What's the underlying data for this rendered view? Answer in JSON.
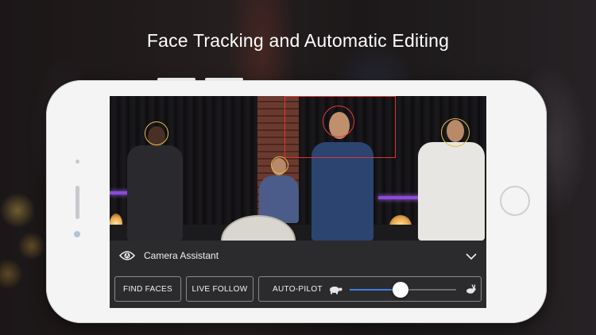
{
  "headline": "Face Tracking and Automatic Editing",
  "assistant": {
    "label": "Camera Assistant",
    "icon": "eye-icon",
    "toggle_icon": "chevron-down-icon"
  },
  "controls": {
    "find_faces_label": "FIND FACES",
    "live_follow_label": "LIVE FOLLOW",
    "autopilot_label": "AUTO-PILOT",
    "speed_slow_icon": "turtle-icon",
    "speed_fast_icon": "hare-icon",
    "speed_value": 0.48
  },
  "colors": {
    "accent": "#3e7fe0",
    "face_ring": "#e3c04a",
    "selected_face": "#e23b3b",
    "panel": "#2b2b2d"
  }
}
